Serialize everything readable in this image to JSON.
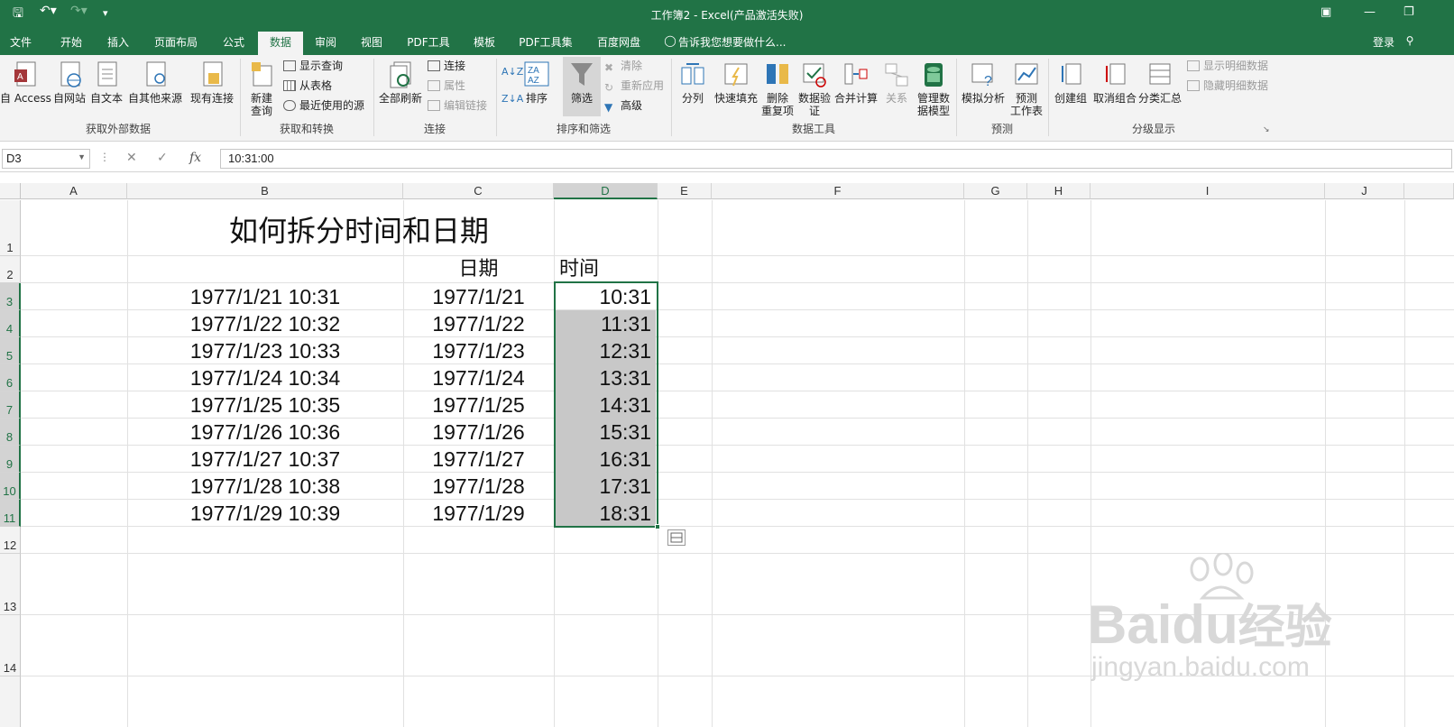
{
  "window": {
    "title": "工作簿2 - Excel(产品激活失败)",
    "login": "登录"
  },
  "tabs": [
    "文件",
    "开始",
    "插入",
    "页面布局",
    "公式",
    "数据",
    "审阅",
    "视图",
    "PDF工具",
    "模板",
    "PDF工具集",
    "百度网盘"
  ],
  "active_tab": "数据",
  "tell_me": "告诉我您想要做什么...",
  "ribbon": {
    "groups": {
      "external": "获取外部数据",
      "transform": "获取和转换",
      "connections": "连接",
      "sort_filter": "排序和筛选",
      "data_tools": "数据工具",
      "forecast": "预测",
      "outline": "分级显示"
    },
    "buttons": {
      "access": "自 Access",
      "web": "自网站",
      "text": "自文本",
      "other": "自其他来源",
      "existing": "现有连接",
      "new_query_1": "新建",
      "new_query_2": "查询",
      "show_query": "显示查询",
      "from_table": "从表格",
      "recent": "最近使用的源",
      "refresh_all": "全部刷新",
      "connections": "连接",
      "properties": "属性",
      "edit_links": "编辑链接",
      "sort": "排序",
      "filter": "筛选",
      "clear": "清除",
      "reapply": "重新应用",
      "advanced": "高级",
      "split": "分列",
      "flash_fill": "快速填充",
      "remove_dup_1": "删除",
      "remove_dup_2": "重复项",
      "validation_1": "数据验",
      "validation_2": "证",
      "consolidate": "合并计算",
      "relations": "关系",
      "manage_model_1": "管理数",
      "manage_model_2": "据模型",
      "what_if": "模拟分析",
      "forecast_1": "预测",
      "forecast_2": "工作表",
      "group": "创建组",
      "ungroup": "取消组合",
      "subtotal": "分类汇总",
      "show_detail": "显示明细数据",
      "hide_detail": "隐藏明细数据"
    }
  },
  "formula_bar": {
    "name_box": "D3",
    "formula": "10:31:00"
  },
  "columns": [
    "A",
    "B",
    "C",
    "D",
    "E",
    "F",
    "G",
    "H",
    "I",
    "J"
  ],
  "rows": [
    "1",
    "2",
    "3",
    "4",
    "5",
    "6",
    "7",
    "8",
    "9",
    "10",
    "11",
    "12",
    "13",
    "14"
  ],
  "sheet": {
    "title": "如何拆分时间和日期",
    "header_date": "日期",
    "header_time": "时间",
    "datetimes": [
      "1977/1/21 10:31",
      "1977/1/22 10:32",
      "1977/1/23 10:33",
      "1977/1/24 10:34",
      "1977/1/25 10:35",
      "1977/1/26 10:36",
      "1977/1/27 10:37",
      "1977/1/28 10:38",
      "1977/1/29 10:39"
    ],
    "dates": [
      "1977/1/21",
      "1977/1/22",
      "1977/1/23",
      "1977/1/24",
      "1977/1/25",
      "1977/1/26",
      "1977/1/27",
      "1977/1/28",
      "1977/1/29"
    ],
    "times": [
      "10:31",
      "11:31",
      "12:31",
      "13:31",
      "14:31",
      "15:31",
      "16:31",
      "17:31",
      "18:31"
    ]
  },
  "watermark": {
    "brand": "Baidu",
    "cn": "经验",
    "url": "jingyan.baidu.com"
  },
  "colors": {
    "accent": "#217346",
    "selection_fill": "#c8c8c8"
  }
}
